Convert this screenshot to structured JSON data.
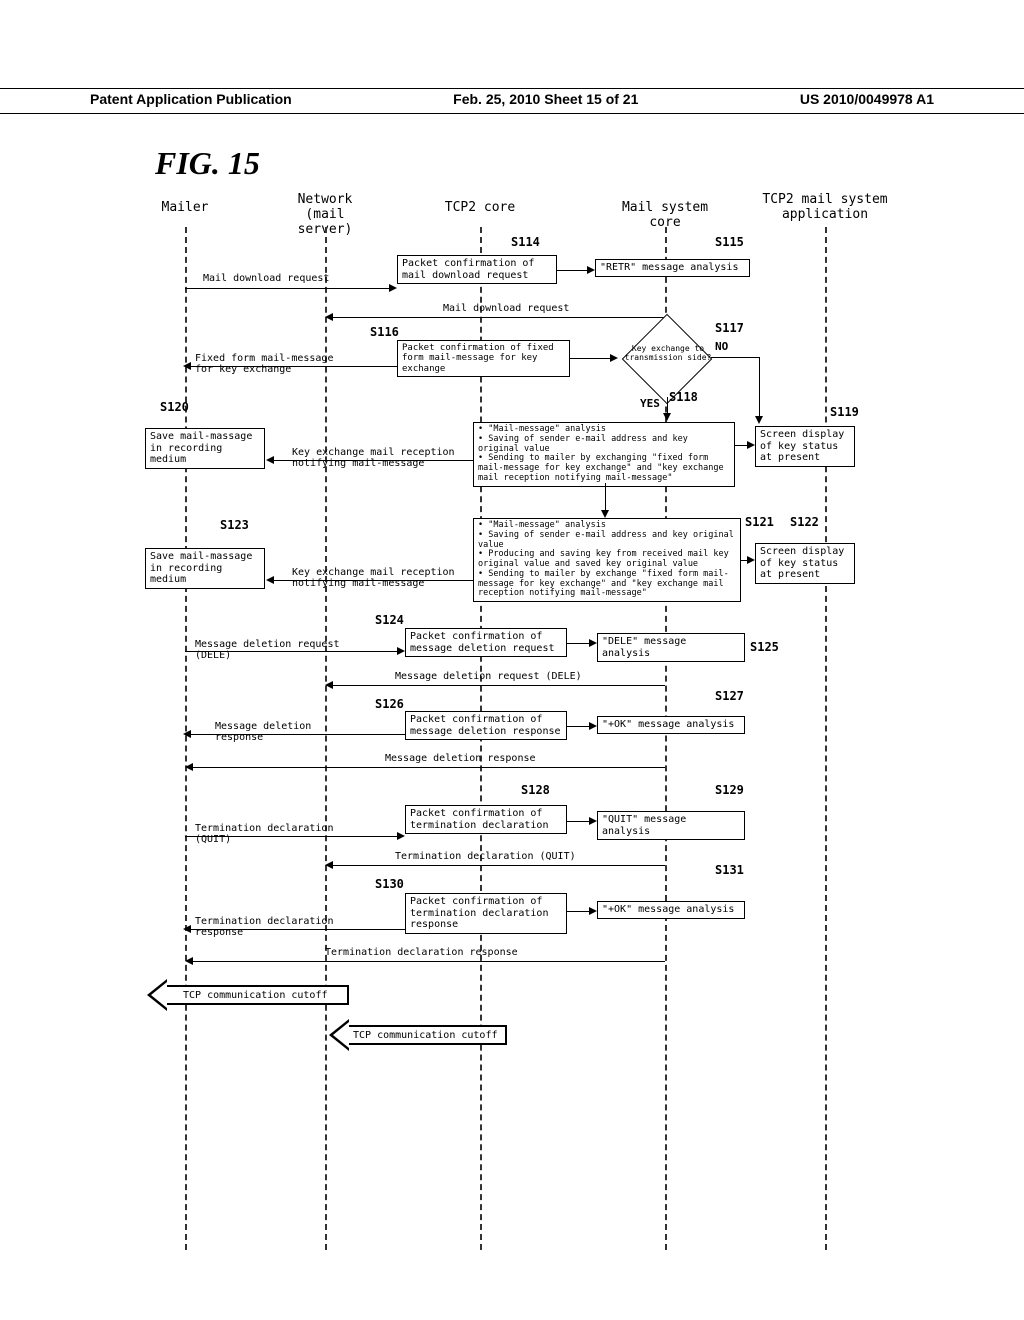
{
  "header": {
    "left": "Patent Application Publication",
    "center": "Feb. 25, 2010  Sheet 15 of 21",
    "right": "US 2010/0049978 A1"
  },
  "figure_title": "FIG. 15",
  "lanes": {
    "mailer": "Mailer",
    "network": "Network\n(mail server)",
    "tcp2core": "TCP2 core",
    "mailcore": "Mail system core",
    "tcp2app": "TCP2 mail system\napplication"
  },
  "step_labels": {
    "s114": "S114",
    "s115": "S115",
    "s116": "S116",
    "s117": "S117",
    "s118": "S118",
    "s119": "S119",
    "s120": "S120",
    "s121": "S121",
    "s122": "S122",
    "s123": "S123",
    "s124": "S124",
    "s125": "S125",
    "s126": "S126",
    "s127": "S127",
    "s128": "S128",
    "s129": "S129",
    "s130": "S130",
    "s131": "S131"
  },
  "messages": {
    "mail_dl_req": "Mail download request",
    "mail_dl_req2": "Mail download request",
    "fixed_form": "Fixed form mail-message\nfor key exchange",
    "key_ex_notify": "Key exchange mail reception\nnotifying mail-message",
    "msg_del_req": "Message deletion request\n(DELE)",
    "msg_del_req2": "Message deletion request (DELE)",
    "msg_del_resp": "Message deletion\nresponse",
    "msg_del_resp2": "Message deletion response",
    "term_decl": "Termination declaration\n(QUIT)",
    "term_decl2": "Termination declaration (QUIT)",
    "term_decl_resp": "Termination declaration\nresponse",
    "term_decl_resp2": "Termination declaration response",
    "tcp_cutoff": "TCP communication cutoff",
    "tcp_cutoff2": "TCP communication cutoff"
  },
  "boxes": {
    "s114": "Packet confirmation of\nmail download request",
    "s115": "\"RETR\" message analysis",
    "s116": "Packet confirmation of fixed\nform mail-message for key\nexchange",
    "diamond": "Key exchange\nto transmission\nside?",
    "no": "NO",
    "yes": "YES",
    "s118_bullets": [
      "\"Mail-message\" analysis",
      "Saving of sender e-mail address and key original value",
      "Sending to mailer by exchanging \"fixed form mail-message for key exchange\" and \"key exchange mail reception notifying mail-message\""
    ],
    "s119": "Screen display\nof key status\nat present",
    "s120": "Save mail-massage\nin recording\nmedium",
    "s121_bullets": [
      "\"Mail-message\" analysis",
      "Saving of sender e-mail address and key original value",
      "Producing and saving key from received mail key original value and saved key original value",
      "Sending to mailer by exchange \"fixed form mail-message for key exchange\" and \"key exchange mail reception notifying mail-message\""
    ],
    "s122": "Screen display\nof key status\nat present",
    "s123": "Save mail-massage\nin recording\nmedium",
    "s124": "Packet confirmation of\nmessage deletion request",
    "s125": "\"DELE\" message analysis",
    "s126": "Packet confirmation of\nmessage deletion response",
    "s127": "\"+OK\" message analysis",
    "s128": "Packet confirmation of\ntermination declaration",
    "s129": "\"QUIT\" message analysis",
    "s130": "Packet confirmation of\ntermination declaration\nresponse",
    "s131": "\"+OK\" message analysis"
  }
}
